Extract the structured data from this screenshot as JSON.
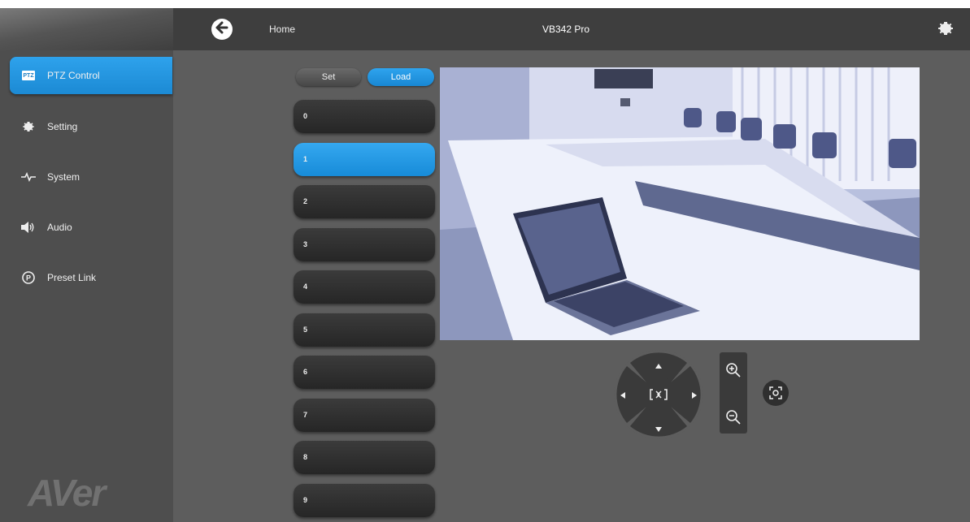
{
  "header": {
    "breadcrumb": "Home",
    "title": "VB342 Pro"
  },
  "sidebar": {
    "items": [
      {
        "label": "PTZ Control",
        "icon": "ptz-badge-icon",
        "badge": "PTZ",
        "active": true
      },
      {
        "label": "Setting",
        "icon": "gear-icon",
        "active": false
      },
      {
        "label": "System",
        "icon": "pulse-icon",
        "active": false
      },
      {
        "label": "Audio",
        "icon": "speaker-icon",
        "active": false
      },
      {
        "label": "Preset Link",
        "icon": "preset-link-icon",
        "active": false
      }
    ],
    "logo": "AVer"
  },
  "presets": {
    "set_label": "Set",
    "load_label": "Load",
    "items": [
      "0",
      "1",
      "2",
      "3",
      "4",
      "5",
      "6",
      "7",
      "8",
      "9"
    ],
    "selected": "1"
  },
  "controls": {
    "icons": [
      "up-arrow-icon",
      "down-arrow-icon",
      "left-arrow-icon",
      "right-arrow-icon",
      "center-home-icon",
      "zoom-in-icon",
      "zoom-out-icon",
      "focus-reset-icon"
    ]
  },
  "colors": {
    "accent": "#1f93e0",
    "header": "#3e3e3e",
    "sidebar": "#4e4e4e",
    "content": "#5d5d5d"
  }
}
